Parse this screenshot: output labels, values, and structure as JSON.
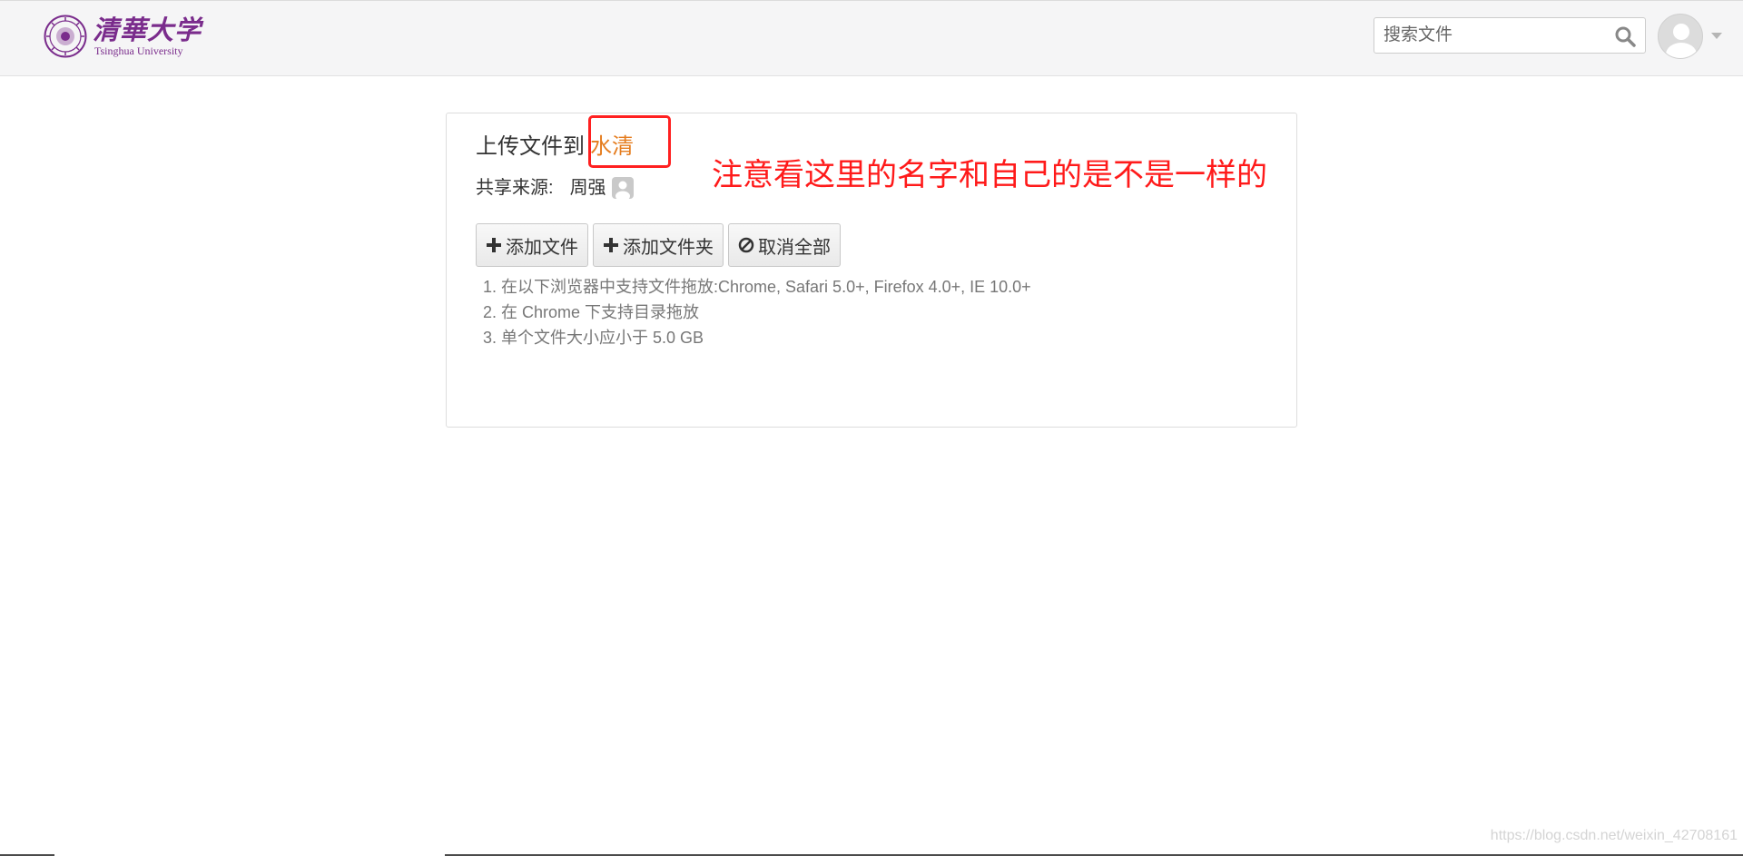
{
  "header": {
    "logo": {
      "name_cn": "清華大学",
      "name_en": "Tsinghua University"
    },
    "search": {
      "placeholder": "搜索文件"
    }
  },
  "upload": {
    "title_prefix": "上传文件到",
    "target_name": "水清",
    "share_label": "共享来源:",
    "share_user": "周强",
    "buttons": {
      "add_file": "添加文件",
      "add_folder": "添加文件夹",
      "cancel_all": "取消全部"
    },
    "tips": [
      "1. 在以下浏览器中支持文件拖放:Chrome, Safari 5.0+, Firefox 4.0+, IE 10.0+",
      "2. 在 Chrome 下支持目录拖放",
      "3. 单个文件大小应小于 5.0 GB"
    ]
  },
  "annotation": {
    "text": "注意看这里的名字和自己的是不是一样的",
    "color": "#ff1a1a"
  },
  "watermark": "https://blog.csdn.net/weixin_42708161",
  "colors": {
    "brand": "#7a2c8c",
    "target_name": "#e57d1f",
    "highlight_box": "#ff2020"
  }
}
